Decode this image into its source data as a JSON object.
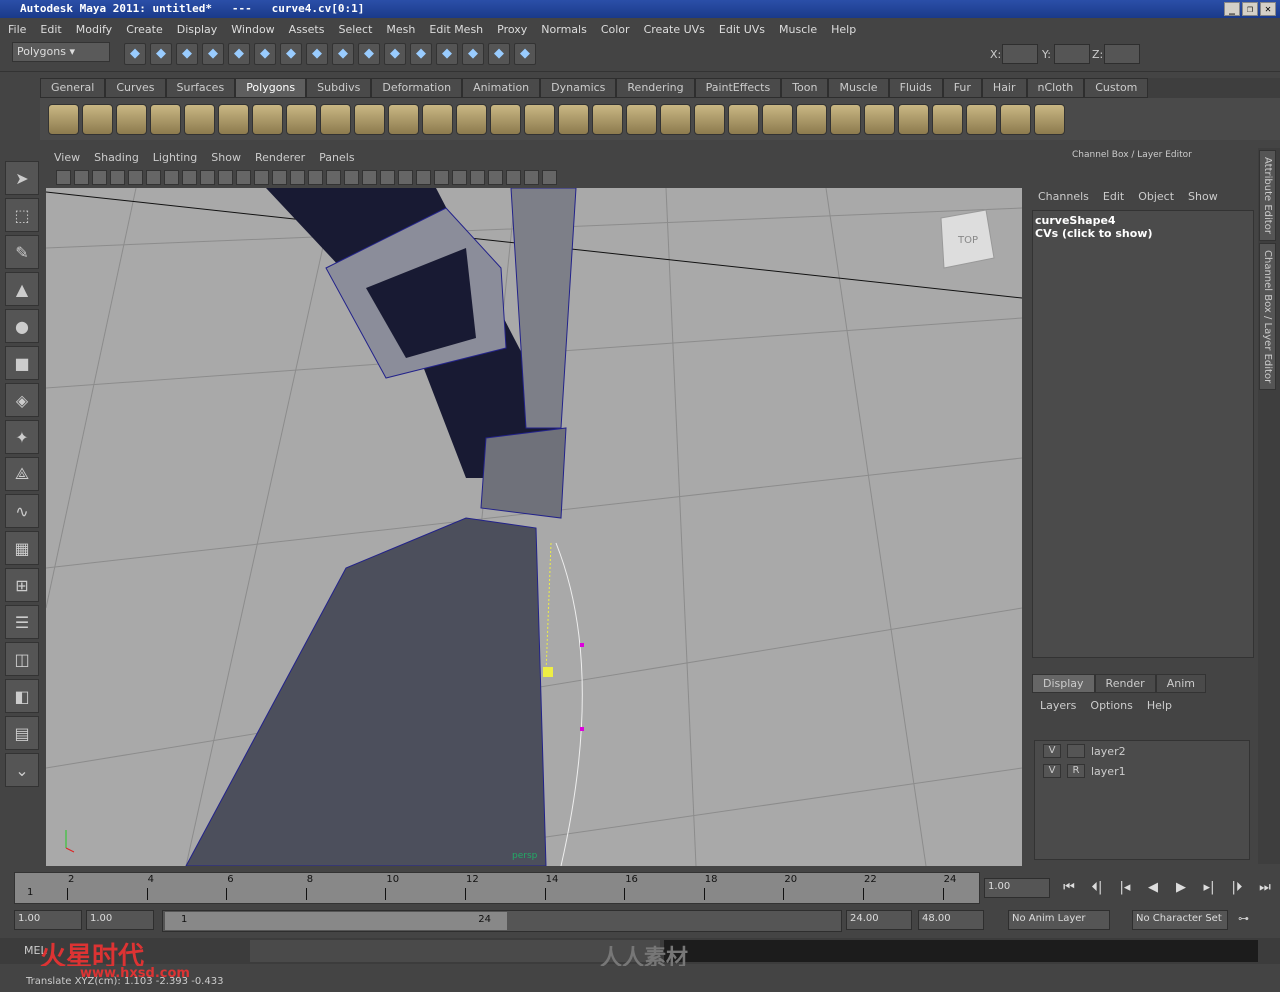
{
  "window": {
    "title": "Autodesk Maya 2011: untitled*   ---   curve4.cv[0:1]",
    "controls": [
      "_",
      "❐",
      "✕"
    ]
  },
  "menu": [
    "File",
    "Edit",
    "Modify",
    "Create",
    "Display",
    "Window",
    "Assets",
    "Select",
    "Mesh",
    "Edit Mesh",
    "Proxy",
    "Normals",
    "Color",
    "Create UVs",
    "Edit UVs",
    "Muscle",
    "Help"
  ],
  "status": {
    "menu_set": "Polygons",
    "xyz": [
      "X:",
      "Y:",
      "Z:"
    ]
  },
  "shelf": {
    "tabs": [
      "General",
      "Curves",
      "Surfaces",
      "Polygons",
      "Subdivs",
      "Deformation",
      "Animation",
      "Dynamics",
      "Rendering",
      "PaintEffects",
      "Toon",
      "Muscle",
      "Fluids",
      "Fur",
      "Hair",
      "nCloth",
      "Custom"
    ],
    "active": "Polygons"
  },
  "viewport": {
    "menu": [
      "View",
      "Shading",
      "Lighting",
      "Show",
      "Renderer",
      "Panels"
    ],
    "viewcube": "TOP",
    "label": "persp"
  },
  "channel_box": {
    "title": "Channel Box / Layer Editor",
    "menu": [
      "Channels",
      "Edit",
      "Object",
      "Show"
    ],
    "object": "curveShape4",
    "cvs": "CVs (click to show)"
  },
  "layer_editor": {
    "tabs": [
      "Display",
      "Render",
      "Anim"
    ],
    "active": "Display",
    "menu": [
      "Layers",
      "Options",
      "Help"
    ],
    "layers": [
      {
        "v": "V",
        "r": "",
        "name": "layer2"
      },
      {
        "v": "V",
        "r": "R",
        "name": "layer1"
      }
    ]
  },
  "side_tabs": [
    "Attribute Editor",
    "Channel Box / Layer Editor"
  ],
  "timeline": {
    "ticks": [
      "2",
      "4",
      "6",
      "8",
      "10",
      "12",
      "14",
      "16",
      "18",
      "20",
      "22",
      "24"
    ],
    "start_label": "1",
    "current": "1.00"
  },
  "range": {
    "start": "1.00",
    "playback_start": "1.00",
    "slider_start": "1",
    "slider_end": "24",
    "playback_end": "24.00",
    "end": "48.00",
    "anim_layer": "No Anim Layer",
    "char_set": "No Character Set"
  },
  "command": {
    "lang": "MEL"
  },
  "help_line": "Translate XYZ(cm): 1.103  -2.393  -0.433",
  "watermarks": [
    "火星时代",
    "www.hxsd.com",
    "人人素材"
  ]
}
